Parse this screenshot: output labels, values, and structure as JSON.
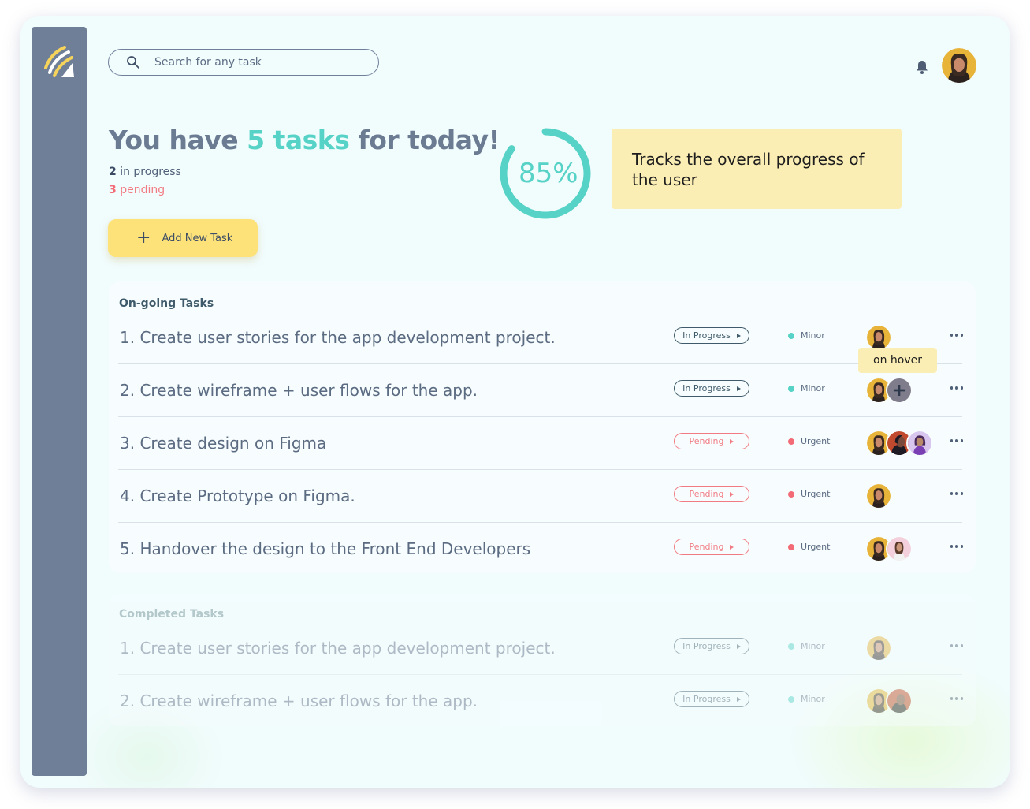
{
  "search": {
    "placeholder": "Search for any task"
  },
  "header": {
    "headline_prefix": "You have ",
    "headline_highlight": "5 tasks",
    "headline_suffix": " for today!",
    "in_progress_count": "2",
    "in_progress_label": " in progress",
    "pending_count": "3",
    "pending_label": " pending"
  },
  "add_button": {
    "label": "Add New Task"
  },
  "progress": {
    "value": 85,
    "label": "85%",
    "note": "Tracks the overall progress of the user"
  },
  "ongoing": {
    "title": "On-going Tasks",
    "tasks": [
      {
        "text": "1. Create user stories for the app development project.",
        "status": "In Progress",
        "priority": "Minor"
      },
      {
        "text": "2. Create wireframe + user flows for the app.",
        "status": "In Progress",
        "priority": "Minor"
      },
      {
        "text": "3. Create design on Figma",
        "status": "Pending",
        "priority": "Urgent"
      },
      {
        "text": "4. Create Prototype on Figma.",
        "status": "Pending",
        "priority": "Urgent"
      },
      {
        "text": "5. Handover the design to the Front End Developers",
        "status": "Pending",
        "priority": "Urgent"
      }
    ]
  },
  "hover_note": "on hover",
  "completed": {
    "title": "Completed Tasks",
    "tasks": [
      {
        "text": "1. Create user stories for the app development project.",
        "status": "In Progress",
        "priority": "Minor"
      },
      {
        "text": "2. Create wireframe + user flows for the app.",
        "status": "In Progress",
        "priority": "Minor"
      }
    ]
  },
  "icons": {
    "logo": "logo-icon",
    "search": "search-icon",
    "bell": "bell-icon",
    "add": "plus-icon",
    "status_arrow": "caret-right-icon",
    "more": "more-dots-icon"
  },
  "colors": {
    "accent_teal": "#56d2c6",
    "pending_red": "#f27b83",
    "sidebar": "#6f7f98",
    "button_yellow": "#fde27a",
    "note_yellow": "#fbeeb5"
  }
}
